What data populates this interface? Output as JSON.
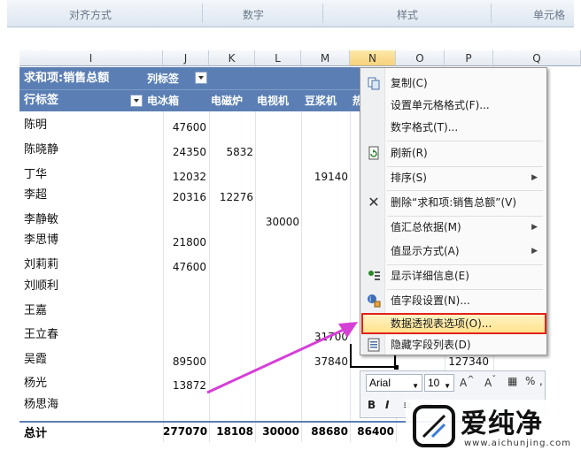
{
  "ribbon": {
    "groups": [
      "对齐方式",
      "数字",
      "样式",
      "单元格"
    ]
  },
  "columns": [
    {
      "label": "I",
      "selected": false
    },
    {
      "label": "J",
      "selected": false
    },
    {
      "label": "K",
      "selected": false
    },
    {
      "label": "L",
      "selected": false
    },
    {
      "label": "M",
      "selected": false
    },
    {
      "label": "N",
      "selected": true
    },
    {
      "label": "O",
      "selected": false
    },
    {
      "label": "P",
      "selected": false
    },
    {
      "label": "Q",
      "selected": false
    }
  ],
  "pivot": {
    "value_field": "求和项:销售总额",
    "col_label": "列标签",
    "row_label": "行标签",
    "col_headers": [
      "电冰箱",
      "电磁炉",
      "电视机",
      "豆浆机",
      "热"
    ],
    "rows": [
      {
        "name": "陈明",
        "values": [
          "47600",
          "",
          "",
          "",
          ""
        ]
      },
      {
        "name": "陈晓静",
        "values": [
          "24350",
          "5832",
          "",
          "",
          ""
        ]
      },
      {
        "name": "丁华",
        "values": [
          "12032",
          "",
          "",
          "19140",
          ""
        ]
      },
      {
        "name": "李超",
        "values": [
          "20316",
          "12276",
          "",
          "",
          ""
        ]
      },
      {
        "name": "李静敏",
        "values": [
          "",
          "",
          "30000",
          "",
          ""
        ]
      },
      {
        "name": "李思博",
        "values": [
          "21800",
          "",
          "",
          "",
          ""
        ]
      },
      {
        "name": "刘莉莉",
        "values": [
          "47600",
          "",
          "",
          "",
          ""
        ]
      },
      {
        "name": "刘顺利",
        "values": [
          "",
          "",
          "",
          "",
          ""
        ]
      },
      {
        "name": "王嘉",
        "values": [
          "",
          "",
          "",
          "",
          ""
        ]
      },
      {
        "name": "王立春",
        "values": [
          "",
          "",
          "",
          "31700",
          ""
        ]
      },
      {
        "name": "吴霞",
        "values": [
          "89500",
          "",
          "",
          "37840",
          ""
        ]
      },
      {
        "name": "杨光",
        "values": [
          "13872",
          "",
          "",
          "",
          ""
        ]
      },
      {
        "name": "杨思海",
        "values": [
          "",
          "",
          "",
          "",
          ""
        ]
      }
    ],
    "extra_value": "127340",
    "total_label": "总计",
    "totals": [
      "277070",
      "18108",
      "30000",
      "88680",
      "86400"
    ]
  },
  "context_menu": {
    "items": [
      {
        "label": "复制(C)",
        "icon": "copy-icon",
        "submenu": false
      },
      {
        "label": "设置单元格格式(F)...",
        "icon": "",
        "submenu": false
      },
      {
        "label": "数字格式(T)...",
        "icon": "",
        "submenu": false
      },
      {
        "label": "刷新(R)",
        "icon": "refresh-icon",
        "submenu": false
      },
      {
        "label": "排序(S)",
        "icon": "",
        "submenu": true
      },
      {
        "label": "删除“求和项:销售总额”(V)",
        "icon": "delete-icon",
        "submenu": false
      },
      {
        "label": "值汇总依据(M)",
        "icon": "",
        "submenu": true
      },
      {
        "label": "值显示方式(A)",
        "icon": "",
        "submenu": true
      },
      {
        "label": "显示详细信息(E)",
        "icon": "show-detail-icon",
        "submenu": false
      },
      {
        "label": "值字段设置(N)...",
        "icon": "field-settings-icon",
        "submenu": false
      },
      {
        "label": "数据透视表选项(O)...",
        "icon": "",
        "submenu": false,
        "highlighted": true
      },
      {
        "label": "隐藏字段列表(D)",
        "icon": "field-list-icon",
        "submenu": false
      }
    ]
  },
  "mini_toolbar": {
    "font": "Arial",
    "size": "10",
    "percent": "%",
    "comma": ",",
    "bold": "B",
    "italic": "I"
  },
  "watermark": {
    "title": "爱纯净",
    "url": "www.aichunjing.com"
  },
  "colors": {
    "pivot_header": "#5b7fb4",
    "highlight_border": "#e2231a",
    "arrow": "#d63fd6"
  }
}
